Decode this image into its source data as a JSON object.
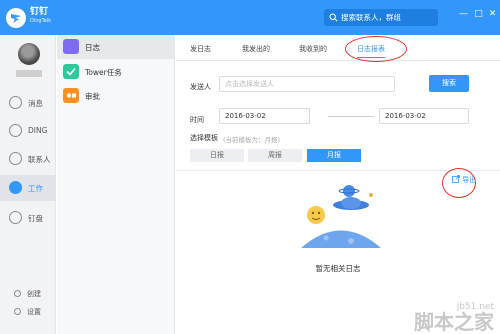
{
  "app": {
    "name": "钉钉",
    "sub": "DingTalk",
    "search_placeholder": "搜索联系人，群组",
    "window_controls": [
      "—",
      "□",
      "✕"
    ]
  },
  "rail": {
    "items": [
      {
        "label": "消息",
        "icon": "chat-icon"
      },
      {
        "label": "DING",
        "icon": "ding-icon"
      },
      {
        "label": "联系人",
        "icon": "contacts-icon"
      },
      {
        "label": "工作",
        "icon": "rocket-icon",
        "active": true
      },
      {
        "label": "钉盘",
        "icon": "cloud-drive-icon"
      }
    ],
    "bottom": [
      {
        "label": "创建",
        "icon": "add-icon"
      },
      {
        "label": "设置",
        "icon": "settings-icon"
      }
    ]
  },
  "panel": {
    "apps": [
      {
        "label": "日志",
        "icon": "journal-icon",
        "color": "#7e6cf0",
        "selected": true
      },
      {
        "label": "Tower任务",
        "icon": "check-icon",
        "color": "#2dc99a"
      },
      {
        "label": "审批",
        "icon": "approval-icon",
        "color": "#ff8f1f"
      }
    ]
  },
  "tabs": [
    "发日志",
    "我发出的",
    "我收到的",
    "日志报表"
  ],
  "form": {
    "sender_label": "发送人",
    "sender_placeholder": "点击选择发送人",
    "search_button": "搜索",
    "time_label": "时间",
    "date_start": "2016-03-02",
    "date_end": "2016-03-02",
    "template_label": "选择模板",
    "template_hint": "(当前模板为：月报)",
    "templates": [
      "日报",
      "周报",
      "月报"
    ],
    "active_template": "月报"
  },
  "export_label": "导出",
  "empty_text": "暂无相关日志",
  "watermark": {
    "line1": "jb51.net",
    "line2": "脚本之家"
  },
  "colors": {
    "brand": "#3296fa",
    "highlight": "#e0352b"
  }
}
